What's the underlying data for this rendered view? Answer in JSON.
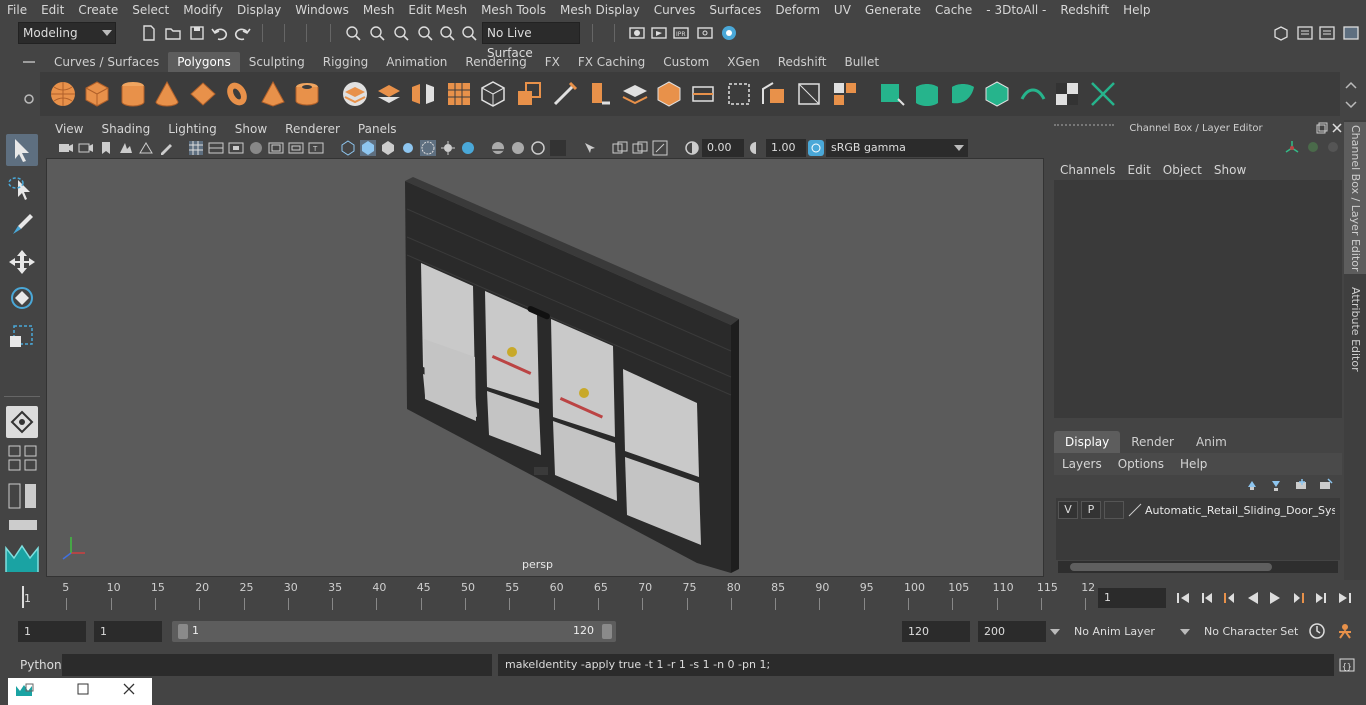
{
  "menubar": [
    "File",
    "Edit",
    "Create",
    "Select",
    "Modify",
    "Display",
    "Windows",
    "Mesh",
    "Edit Mesh",
    "Mesh Tools",
    "Mesh Display",
    "Curves",
    "Surfaces",
    "Deform",
    "UV",
    "Generate",
    "Cache",
    "- 3DtoAll -",
    "Redshift",
    "Help"
  ],
  "statusline": {
    "mode": "Modeling",
    "live_surface": "No Live Surface"
  },
  "shelf_tabs": [
    "Curves / Surfaces",
    "Polygons",
    "Sculpting",
    "Rigging",
    "Animation",
    "Rendering",
    "FX",
    "FX Caching",
    "Custom",
    "XGen",
    "Redshift",
    "Bullet"
  ],
  "shelf_active": "Polygons",
  "viewport": {
    "menu": [
      "View",
      "Shading",
      "Lighting",
      "Show",
      "Renderer",
      "Panels"
    ],
    "exposure": "0.00",
    "gamma": "1.00",
    "color_space": "sRGB gamma",
    "camera": "persp"
  },
  "channel_box": {
    "title": "Channel Box / Layer Editor",
    "menu": [
      "Channels",
      "Edit",
      "Object",
      "Show"
    ],
    "tabs": [
      "Display",
      "Render",
      "Anim"
    ],
    "active_tab": "Display",
    "layer_menu": [
      "Layers",
      "Options",
      "Help"
    ],
    "layer": {
      "v": "V",
      "p": "P",
      "name": "Automatic_Retail_Sliding_Door_Syste"
    }
  },
  "side_tabs": [
    "Channel Box / Layer Editor",
    "Attribute Editor"
  ],
  "timeline": {
    "ticks": [
      "5",
      "10",
      "15",
      "20",
      "25",
      "30",
      "35",
      "40",
      "45",
      "50",
      "55",
      "60",
      "65",
      "70",
      "75",
      "80",
      "85",
      "90",
      "95",
      "100",
      "105",
      "110",
      "115",
      "12"
    ],
    "start_marker": "1",
    "current_frame": "1"
  },
  "range": {
    "start": "1",
    "playback_start": "1",
    "slider_start": "1",
    "slider_end": "120",
    "playback_end": "120",
    "end": "200",
    "anim_layer": "No Anim Layer",
    "character_set": "No Character Set"
  },
  "command_line": {
    "label": "Python",
    "result": "makeIdentity -apply true -t 1 -r 1 -s 1 -n 0 -pn 1;"
  }
}
